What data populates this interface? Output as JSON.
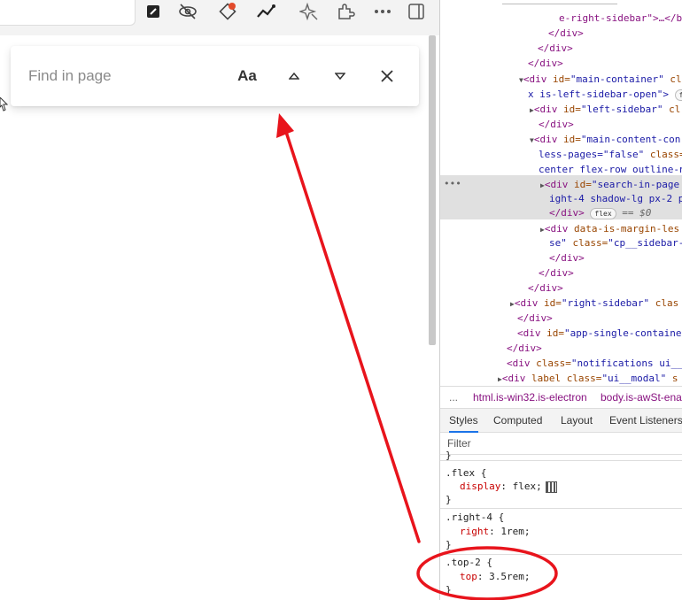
{
  "find_bar": {
    "placeholder": "Find in page",
    "match_case_label": "Aa"
  },
  "toolbar": {
    "icons": [
      "notes-icon",
      "hide-icon",
      "diamond-icon",
      "analytics-icon",
      "sparkle-icon",
      "extension-icon",
      "more-icon",
      "sidebar-icon"
    ]
  },
  "devtools": {
    "dom": {
      "l0": "e-right-sidebar\">…</b",
      "l1": "</div>",
      "l2": "</div>",
      "l3": "</div>",
      "l4_tag": "<div ",
      "l4_an": "id=",
      "l4_av": "\"main-container\"",
      "l4_rest": " cl",
      "l5_av": "x is-left-sidebar-open\">",
      "l6_tag": "<div ",
      "l6_an": "id=",
      "l6_av": "\"left-sidebar\"",
      "l6_rest": " cl",
      "l7": "</div>",
      "l8_tag": "<div ",
      "l8_an": "id=",
      "l8_av": "\"main-content-con",
      "l9_av": "less-pages=\"false\"",
      "l9_an": " class=",
      "l10_av": "center flex-row outline-n",
      "l11_tag": "<div ",
      "l11_an": "id=",
      "l11_av": "\"search-in-page",
      "l12_av": "ight-4 shadow-lg px-2 p",
      "l13_tag": "</div>",
      "l13_pill": "flex",
      "l13_eq": "== $0",
      "l14_tag": "<div ",
      "l14_an": "data-is-margin-les",
      "l15_av": "se\"",
      "l15_an": " class=",
      "l15_av2": "\"cp__sidebar-",
      "l16": "</div>",
      "l17": "</div>",
      "l18": "</div>",
      "l19_tag": "<div ",
      "l19_an": "id=",
      "l19_av": "\"right-sidebar\"",
      "l19_rest": " clas",
      "l20": "</div>",
      "l21_tag": "<div ",
      "l21_an": "id=",
      "l21_av": "\"app-single-containe",
      "l22": "</div>",
      "l23_tag": "<div ",
      "l23_an": "class=",
      "l23_av": "\"notifications ui__",
      "l24_tag": "<div ",
      "l24_an": "label class=",
      "l24_av": "\"ui__modal\"",
      "l24_rest": " s",
      "dots": "•••"
    },
    "breadcrumbs": {
      "ellipsis": "...",
      "html": "html.is-win32.is-electron",
      "body": "body.is-awSt-ena"
    },
    "tabs": [
      "Styles",
      "Computed",
      "Layout",
      "Event Listeners"
    ],
    "filter_placeholder": "Filter",
    "rules": {
      "r0_close": "}",
      "flex_sel": ".flex {",
      "flex_prop": "display",
      "flex_val": ": flex;",
      "flex_close": "}",
      "right_sel": ".right-4 {",
      "right_prop": "right",
      "right_val": ": 1rem;",
      "right_close": "}",
      "top_sel": ".top-2 {",
      "top_prop": "top",
      "top_val": ": 3.5rem;",
      "top_close": "}"
    }
  },
  "colors": {
    "annotation": "#e8141c",
    "selection": "#e0e0e0"
  }
}
